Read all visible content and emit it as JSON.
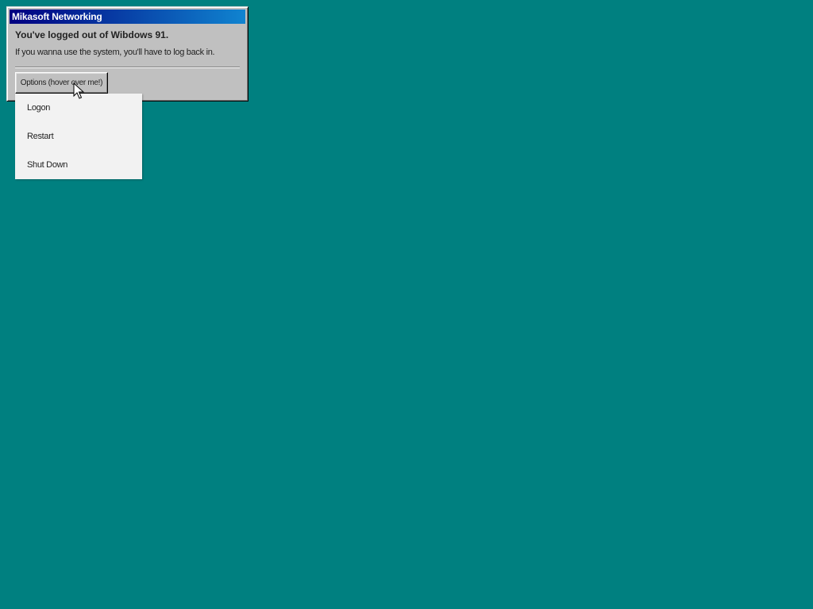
{
  "window": {
    "title": "Mikasoft Networking",
    "heading": "You've logged out of Wibdows 91.",
    "message": "If you wanna use the system, you'll have to log back in.",
    "options_button_label": "Options (hover over me!)"
  },
  "dropdown": {
    "items": [
      {
        "label": "Logon"
      },
      {
        "label": "Restart"
      },
      {
        "label": "Shut Down"
      }
    ]
  },
  "colors": {
    "desktop": "#008080",
    "titlebar_start": "#000080",
    "titlebar_end": "#1084d0",
    "window_face": "#c0c0c0",
    "menu_background": "#f2f2f2"
  },
  "icons": {
    "cursor": "pointer-cursor-icon"
  }
}
